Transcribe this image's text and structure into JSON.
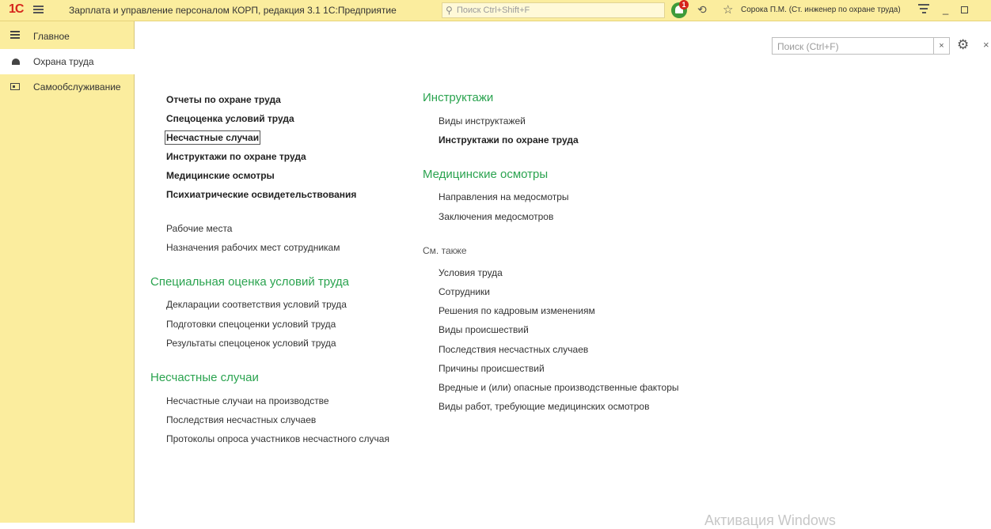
{
  "titlebar": {
    "logo": "1С",
    "app_title": "Зарплата и управление персоналом КОРП, редакция 3.1 1С:Предприятие",
    "search_placeholder": "Поиск Ctrl+Shift+F",
    "notification_count": "1",
    "user": "Сорока П.М. (Ст. инженер по охране труда)"
  },
  "sidebar": {
    "items": [
      {
        "label": "Главное",
        "icon": "menu-icon",
        "active": false
      },
      {
        "label": "Охрана труда",
        "icon": "helmet-icon",
        "active": true
      },
      {
        "label": "Самообслуживание",
        "icon": "id-card-icon",
        "active": false
      }
    ]
  },
  "search": {
    "placeholder": "Поиск (Ctrl+F)",
    "value": "",
    "clear": "×"
  },
  "left_column": {
    "main_links": [
      "Отчеты по охране труда",
      "Спецоценка условий труда",
      "Несчастные случаи",
      "Инструктажи по охране труда",
      "Медицинские осмотры",
      "Психиатрические освидетельствования"
    ],
    "plain_links": [
      "Рабочие места",
      "Назначения рабочих мест сотрудникам"
    ],
    "sout": {
      "title": "Специальная оценка условий труда",
      "links": [
        "Декларации соответствия условий труда",
        "Подготовки спецоценки условий труда",
        "Результаты спецоценок условий труда"
      ]
    },
    "accidents": {
      "title": "Несчастные случаи",
      "links": [
        "Несчастные случаи на производстве",
        "Последствия несчастных случаев",
        "Протоколы опроса участников несчастного случая"
      ]
    }
  },
  "right_column": {
    "briefings": {
      "title": "Инструктажи",
      "links": [
        "Виды инструктажей",
        "Инструктажи по охране труда"
      ]
    },
    "medical": {
      "title": "Медицинские осмотры",
      "links": [
        "Направления на медосмотры",
        "Заключения медосмотров"
      ]
    },
    "see_also": {
      "title": "См. также",
      "links": [
        "Условия труда",
        "Сотрудники",
        "Решения по кадровым изменениям",
        "Виды происшествий",
        "Последствия несчастных случаев",
        "Причины происшествий",
        "Вредные и (или) опасные производственные факторы",
        "Виды работ, требующие медицинских осмотров"
      ]
    }
  },
  "watermark": "Активация Windows",
  "colors": {
    "chrome": "#fbed9e",
    "section_title": "#2aa34f",
    "text": "#333333"
  }
}
